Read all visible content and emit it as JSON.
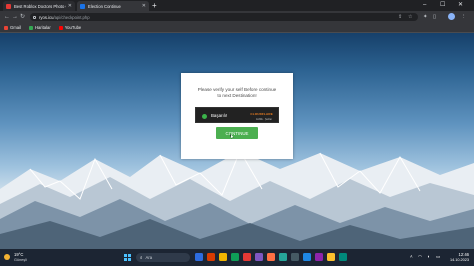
{
  "tabs": [
    {
      "title": "Best Roblox Doctors Photo Co...",
      "active": false,
      "favicon_color": "#e53935"
    },
    {
      "title": "Election Continue",
      "active": true,
      "favicon_color": "#1a73e8"
    }
  ],
  "address_bar": {
    "host": "ryos.icu",
    "path": "/api/checkpoint.php"
  },
  "bookmarks": [
    {
      "label": "Gmail",
      "icon": "gmail-icon",
      "color": "#ea4335"
    },
    {
      "label": "Haritalar",
      "icon": "maps-icon",
      "color": "#34a853"
    },
    {
      "label": "YouTube",
      "icon": "youtube-icon",
      "color": "#ff0000"
    }
  ],
  "modal": {
    "message_line1": "Please verify your self Before continue",
    "message_line2": "to next Destination!",
    "captcha_label": "Başarılı!",
    "captcha_brand": "CLOUDFLARE",
    "captcha_links": "Gizlilik · Şartlar",
    "button_label": "CONTINUE"
  },
  "taskbar": {
    "weather_temp": "19°C",
    "weather_cond": "Güneşli",
    "search_label": "Ara",
    "time": "12:46",
    "date": "14.10.2023"
  },
  "colors": {
    "accent_green": "#4caf50",
    "captcha_success": "#3bb34a",
    "cloudflare_orange": "#f38020"
  }
}
